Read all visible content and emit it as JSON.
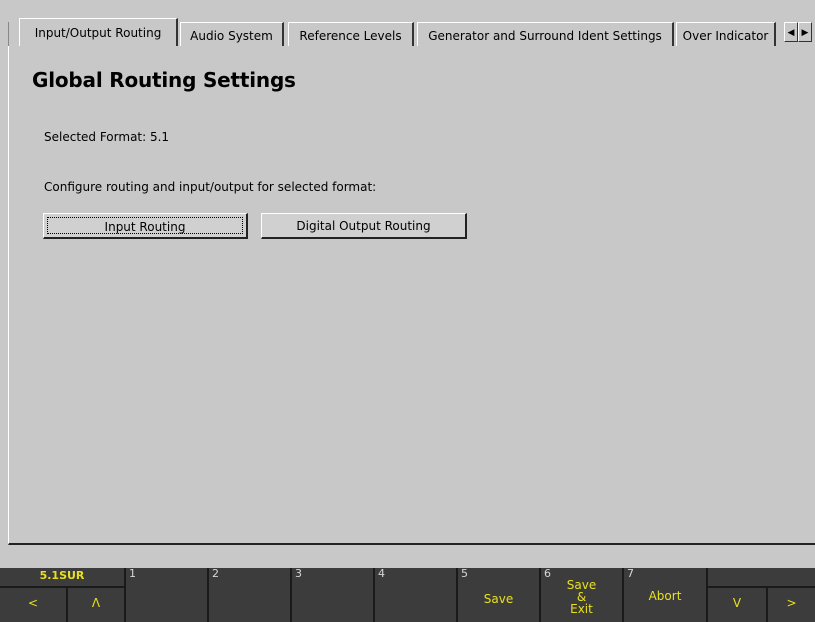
{
  "tabs": [
    {
      "label": "Input/Output Routing",
      "active": true
    },
    {
      "label": "Audio System"
    },
    {
      "label": "Reference Levels"
    },
    {
      "label": "Generator and Surround Ident Settings"
    },
    {
      "label": "Over Indicator"
    }
  ],
  "tab_scroll": {
    "left": "◀",
    "right": "▶"
  },
  "page": {
    "title": "Global Routing Settings",
    "selected_format": "Selected Format: 5.1",
    "configure_text": "Configure routing and input/output for selected format:",
    "input_routing_button": "Input Routing",
    "digital_output_routing_button": "Digital Output Routing"
  },
  "bottombar": {
    "status": "5.1SUR",
    "left_arrow": "<",
    "up_arrow": "Λ",
    "down_arrow": "V",
    "right_arrow": ">",
    "keys": [
      {
        "num": "1",
        "label": ""
      },
      {
        "num": "2",
        "label": ""
      },
      {
        "num": "3",
        "label": ""
      },
      {
        "num": "4",
        "label": ""
      },
      {
        "num": "5",
        "label": "Save"
      },
      {
        "num": "6",
        "label_line1": "Save",
        "label_line2": "&",
        "label_line3": "Exit"
      },
      {
        "num": "7",
        "label": "Abort"
      }
    ],
    "accent_color": "#e8e020"
  }
}
